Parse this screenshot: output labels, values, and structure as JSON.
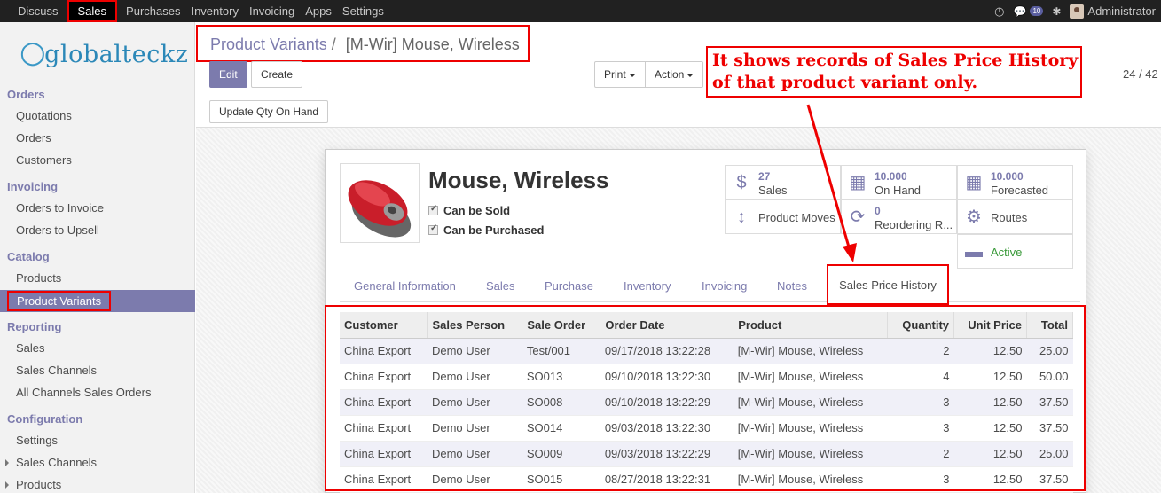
{
  "topbar": {
    "menu": [
      "Discuss",
      "Sales",
      "Purchases",
      "Inventory",
      "Invoicing",
      "Apps",
      "Settings"
    ],
    "active": "Sales",
    "notif_count": "10",
    "user": "Administrator"
  },
  "sidebar": {
    "logo": "globalteckz",
    "sections": [
      {
        "title": "Orders",
        "items": [
          "Quotations",
          "Orders",
          "Customers"
        ]
      },
      {
        "title": "Invoicing",
        "items": [
          "Orders to Invoice",
          "Orders to Upsell"
        ]
      },
      {
        "title": "Catalog",
        "items": [
          "Products",
          "Product Variants"
        ]
      },
      {
        "title": "Reporting",
        "items": [
          "Sales",
          "Sales Channels",
          "All Channels Sales Orders"
        ]
      },
      {
        "title": "Configuration",
        "items": [
          "Settings",
          "Sales Channels",
          "Products"
        ]
      }
    ]
  },
  "breadcrumb": {
    "parent": "Product Variants",
    "separator": "/",
    "current": "[M-Wir] Mouse, Wireless"
  },
  "toolbar": {
    "edit": "Edit",
    "create": "Create",
    "print": "Print",
    "action": "Action",
    "update_qty": "Update Qty On Hand",
    "pager": "24 / 42"
  },
  "annotation": "It shows records of Sales Price History of that product variant only.",
  "product": {
    "name": "Mouse, Wireless",
    "can_be_sold": "Can be Sold",
    "can_be_purchased": "Can be Purchased"
  },
  "smart_buttons": [
    {
      "icon": "dollar-icon",
      "glyph": "$",
      "num": "27",
      "label": "Sales"
    },
    {
      "icon": "building-icon",
      "glyph": "▦",
      "num": "10.000",
      "label": "On Hand"
    },
    {
      "icon": "building-icon",
      "glyph": "▦",
      "num": "10.000",
      "label": "Forecasted"
    },
    {
      "icon": "arrows-v-icon",
      "glyph": "↕",
      "num": "",
      "label": "Product Moves"
    },
    {
      "icon": "refresh-icon",
      "glyph": "⟳",
      "num": "0",
      "label": "Reordering R..."
    },
    {
      "icon": "cogs-icon",
      "glyph": "⚙",
      "num": "",
      "label": "Routes"
    },
    {
      "icon": "archive-icon",
      "glyph": "▬",
      "num": "",
      "label": "Active"
    }
  ],
  "tabs": [
    "General Information",
    "Sales",
    "Purchase",
    "Inventory",
    "Invoicing",
    "Notes",
    "Sales Price History"
  ],
  "table": {
    "headers": [
      "Customer",
      "Sales Person",
      "Sale Order",
      "Order Date",
      "Product",
      "Quantity",
      "Unit Price",
      "Total"
    ],
    "rows": [
      [
        "China Export",
        "Demo User",
        "Test/001",
        "09/17/2018 13:22:28",
        "[M-Wir] Mouse, Wireless",
        "2",
        "12.50",
        "25.00"
      ],
      [
        "China Export",
        "Demo User",
        "SO013",
        "09/10/2018 13:22:30",
        "[M-Wir] Mouse, Wireless",
        "4",
        "12.50",
        "50.00"
      ],
      [
        "China Export",
        "Demo User",
        "SO008",
        "09/10/2018 13:22:29",
        "[M-Wir] Mouse, Wireless",
        "3",
        "12.50",
        "37.50"
      ],
      [
        "China Export",
        "Demo User",
        "SO014",
        "09/03/2018 13:22:30",
        "[M-Wir] Mouse, Wireless",
        "3",
        "12.50",
        "37.50"
      ],
      [
        "China Export",
        "Demo User",
        "SO009",
        "09/03/2018 13:22:29",
        "[M-Wir] Mouse, Wireless",
        "2",
        "12.50",
        "25.00"
      ],
      [
        "China Export",
        "Demo User",
        "SO015",
        "08/27/2018 13:22:31",
        "[M-Wir] Mouse, Wireless",
        "3",
        "12.50",
        "37.50"
      ]
    ]
  },
  "colors": {
    "accent": "#7c7bad",
    "annotation": "#ee0000",
    "topbar": "#212121"
  }
}
